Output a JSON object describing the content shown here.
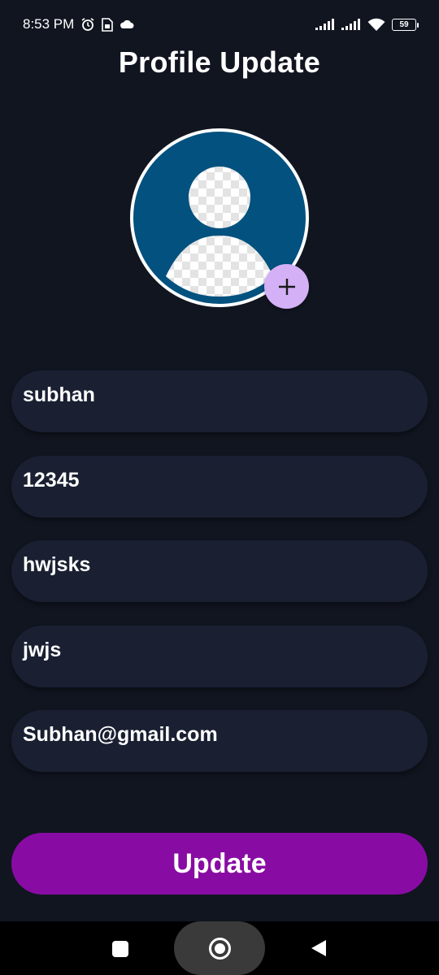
{
  "status_bar": {
    "time": "8:53 PM",
    "battery": "59",
    "icons": [
      "alarm-icon",
      "sim-card-icon",
      "cloud-icon",
      "signal-icon",
      "signal-icon",
      "wifi-icon",
      "battery-icon"
    ]
  },
  "header": {
    "title": "Profile Update"
  },
  "avatar": {
    "icon": "person-placeholder-icon",
    "add_icon": "plus-icon",
    "add_glyph": "+"
  },
  "form": {
    "fields": [
      {
        "value": "subhan"
      },
      {
        "value": "12345"
      },
      {
        "value": "hwjsks"
      },
      {
        "value": "jwjs"
      },
      {
        "value": "Subhan@gmail.com"
      }
    ]
  },
  "actions": {
    "update_label": "Update"
  },
  "nav_bar": {
    "icons": [
      "recents-square-icon",
      "home-circle-icon",
      "back-triangle-icon"
    ]
  },
  "colors": {
    "background": "#111520",
    "field": "#1a2032",
    "avatar": "#02517f",
    "add_button": "#d4b0f7",
    "update_button": "#880ca3"
  }
}
